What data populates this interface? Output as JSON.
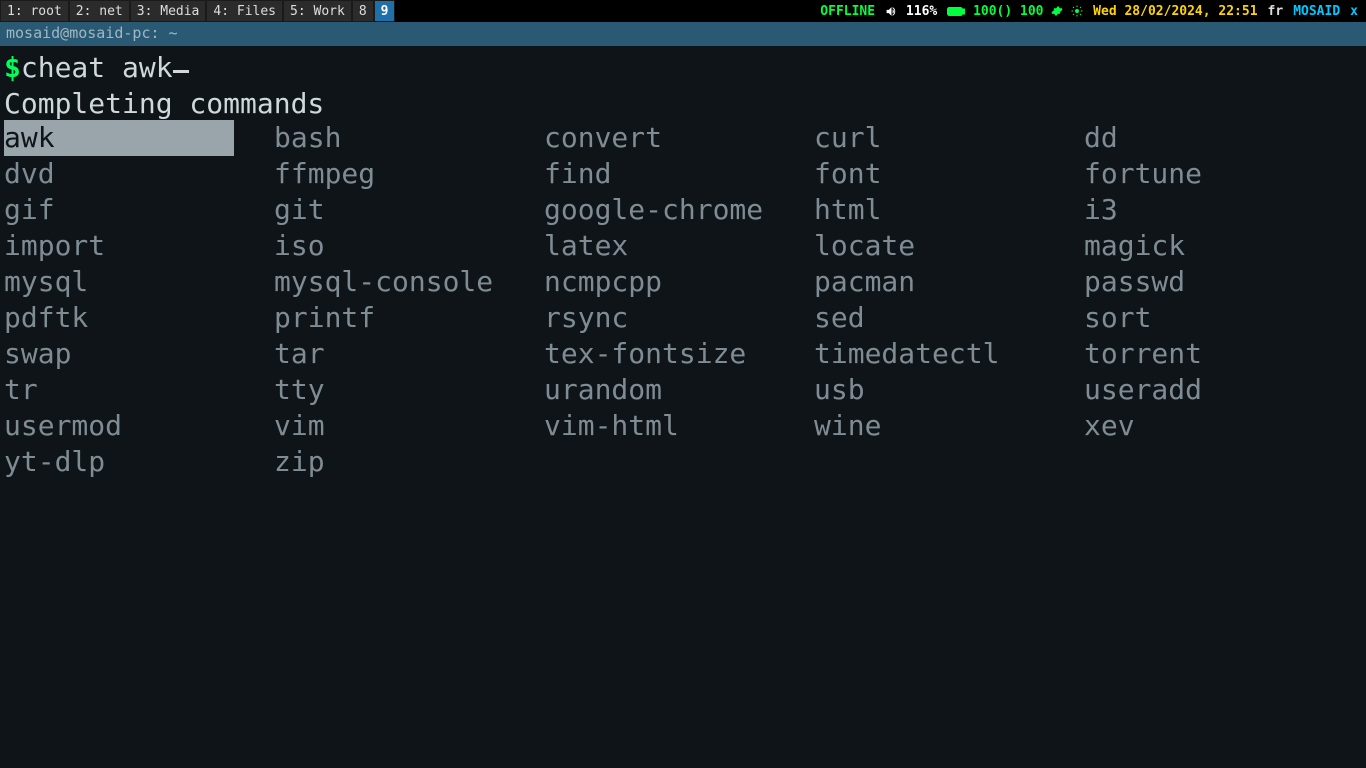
{
  "bar": {
    "workspaces": [
      {
        "label": "1: root",
        "active": false
      },
      {
        "label": "2: net",
        "active": false
      },
      {
        "label": "3: Media",
        "active": false
      },
      {
        "label": "4: Files",
        "active": false
      },
      {
        "label": "5: Work",
        "active": false
      },
      {
        "label": "8",
        "active": false
      },
      {
        "label": "9",
        "active": true
      }
    ],
    "status": {
      "offline": "OFFLINE",
      "volume": "116%",
      "battery": "100() 100",
      "datetime": "Wed 28/02/2024, 22:51",
      "lang": "fr",
      "host": "MOSAID",
      "close": "x"
    }
  },
  "window": {
    "title": "mosaid@mosaid-pc: ~"
  },
  "terminal": {
    "prompt_symbol": "$",
    "command": "cheat awk",
    "completing_msg": "Completing commands",
    "selected_index": 0,
    "completions": [
      "awk",
      "bash",
      "convert",
      "curl",
      "dd",
      "dvd",
      "ffmpeg",
      "find",
      "font",
      "fortune",
      "gif",
      "git",
      "google-chrome",
      "html",
      "i3",
      "import",
      "iso",
      "latex",
      "locate",
      "magick",
      "mysql",
      "mysql-console",
      "ncmpcpp",
      "pacman",
      "passwd",
      "pdftk",
      "printf",
      "rsync",
      "sed",
      "sort",
      "swap",
      "tar",
      "tex-fontsize",
      "timedatectl",
      "torrent",
      "tr",
      "tty",
      "urandom",
      "usb",
      "useradd",
      "usermod",
      "vim",
      "vim-html",
      "wine",
      "xev",
      "yt-dlp",
      "zip"
    ]
  }
}
